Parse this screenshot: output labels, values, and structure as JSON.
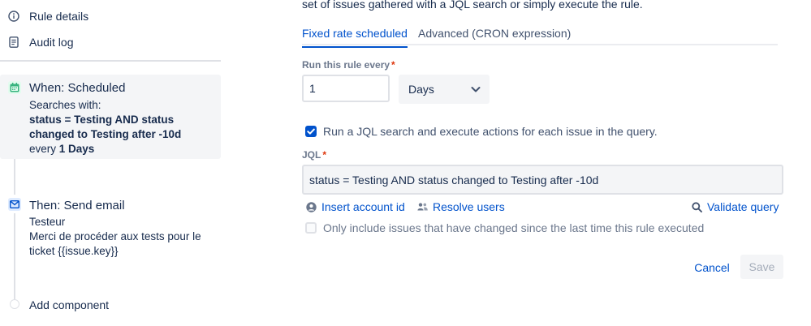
{
  "sidebar": {
    "nav": [
      {
        "label": "Rule details",
        "icon": "info-icon"
      },
      {
        "label": "Audit log",
        "icon": "document-icon"
      }
    ],
    "trigger": {
      "title": "When: Scheduled",
      "searches_prefix": "Searches with:",
      "query": "status = Testing AND status changed to Testing after -10d",
      "every_prefix": "every",
      "every_value": "1 Days",
      "icon": "calendar-icon",
      "icon_color": "#36b37e"
    },
    "action": {
      "title": "Then: Send email",
      "line1": "Testeur",
      "line2": "Merci de procéder aux tests pour le ticket {{issue.key}}",
      "icon": "mail-icon",
      "icon_color": "#4c9aff"
    },
    "add_component": "Add component"
  },
  "main": {
    "intro": "set of issues gathered with a JQL search or simply execute the rule.",
    "tabs": [
      {
        "label": "Fixed rate scheduled",
        "active": true
      },
      {
        "label": "Advanced (CRON expression)",
        "active": false
      }
    ],
    "run_every_label": "Run this rule every",
    "run_every_value": "1",
    "unit_selected": "Days",
    "run_jql_checkbox": {
      "label": "Run a JQL search and execute actions for each issue in the query.",
      "checked": true
    },
    "jql_label": "JQL",
    "jql_value": "status = Testing AND status changed to Testing after -10d",
    "insert_account": "Insert account id",
    "resolve_users": "Resolve users",
    "validate_query": "Validate query",
    "only_changed_checkbox": {
      "label": "Only include issues that have changed since the last time this rule executed",
      "checked": false
    },
    "cancel": "Cancel",
    "save": "Save"
  },
  "colors": {
    "accent": "#0052cc",
    "required": "#de350b"
  }
}
